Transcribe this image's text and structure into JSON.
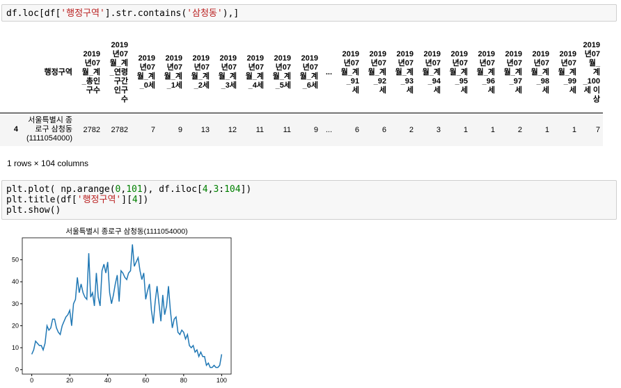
{
  "cell1": {
    "code_parts": [
      "df.loc[df[",
      "'행정구역'",
      "].str.contains(",
      "'삼청동'",
      "),]"
    ]
  },
  "dataframe": {
    "columns": [
      "행정구역",
      "2019 년07 월_계 _총인 구수",
      "2019 년07 월_계 _연령 구간 인구 수",
      "2019 년07 월_계 _0세",
      "2019 년07 월_계 _1세",
      "2019 년07 월_계 _2세",
      "2019 년07 월_계 _3세",
      "2019 년07 월_계 _4세",
      "2019 년07 월_계 _5세",
      "2019 년07 월_계 _6세",
      "...",
      "2019 년07 월_계 _91 세",
      "2019 년07 월_계 _92 세",
      "2019 년07 월_계 _93 세",
      "2019 년07 월_계 _94 세",
      "2019 년07 월_계 _95 세",
      "2019 년07 월_계 _96 세",
      "2019 년07 월_계 _97 세",
      "2019 년07 월_계 _98 세",
      "2019 년07 월_계 _99 세",
      "2019 년07 월_계 _100 세 이 상"
    ],
    "row": {
      "index": "4",
      "values": [
        "서울특별시 종 로구 삼청동 (1111054000)",
        "2782",
        "2782",
        "7",
        "9",
        "13",
        "12",
        "11",
        "11",
        "9",
        "...",
        "6",
        "6",
        "2",
        "3",
        "1",
        "1",
        "2",
        "1",
        "1",
        "7"
      ]
    },
    "shape_text": "1 rows × 104 columns"
  },
  "cell2": {
    "line1": [
      "plt.plot( np.arange(",
      "0",
      ",",
      "101",
      "), df.iloc[",
      "4",
      ",",
      "3",
      ":",
      "104",
      "])"
    ],
    "line2": [
      "plt.title(df[",
      "'행정구역'",
      "][",
      "4",
      "])"
    ],
    "line3": "plt.show()"
  },
  "chart_data": {
    "type": "line",
    "title": "서울특별시 종로구 삼청동(1111054000)",
    "xlim": [
      -5,
      105
    ],
    "ylim": [
      -2,
      60
    ],
    "xticks": [
      0,
      20,
      40,
      60,
      80,
      100
    ],
    "yticks": [
      0,
      10,
      20,
      30,
      40,
      50
    ],
    "line_color": "#1f77b4",
    "x": [
      0,
      1,
      2,
      3,
      4,
      5,
      6,
      7,
      8,
      9,
      10,
      11,
      12,
      13,
      14,
      15,
      16,
      17,
      18,
      19,
      20,
      21,
      22,
      23,
      24,
      25,
      26,
      27,
      28,
      29,
      30,
      31,
      32,
      33,
      34,
      35,
      36,
      37,
      38,
      39,
      40,
      41,
      42,
      43,
      44,
      45,
      46,
      47,
      48,
      49,
      50,
      51,
      52,
      53,
      54,
      55,
      56,
      57,
      58,
      59,
      60,
      61,
      62,
      63,
      64,
      65,
      66,
      67,
      68,
      69,
      70,
      71,
      72,
      73,
      74,
      75,
      76,
      77,
      78,
      79,
      80,
      81,
      82,
      83,
      84,
      85,
      86,
      87,
      88,
      89,
      90,
      91,
      92,
      93,
      94,
      95,
      96,
      97,
      98,
      99,
      100
    ],
    "y": [
      7,
      9,
      13,
      12,
      11,
      11,
      9,
      12,
      20,
      18,
      19,
      23,
      23,
      19,
      17,
      16,
      20,
      22,
      24,
      25,
      27,
      20,
      30,
      32,
      42,
      35,
      39,
      35,
      33,
      32,
      53,
      33,
      35,
      29,
      44,
      33,
      29,
      45,
      48,
      44,
      49,
      35,
      30,
      34,
      39,
      43,
      31,
      45,
      44,
      42,
      41,
      44,
      45,
      57,
      47,
      49,
      51,
      45,
      41,
      44,
      32,
      36,
      39,
      27,
      21,
      31,
      38,
      30,
      22,
      34,
      25,
      29,
      38,
      27,
      19,
      23,
      24,
      17,
      16,
      18,
      17,
      14,
      16,
      11,
      10,
      11,
      8,
      9,
      6,
      8,
      6,
      6,
      2,
      3,
      1,
      1,
      2,
      1,
      1,
      2,
      7
    ]
  }
}
